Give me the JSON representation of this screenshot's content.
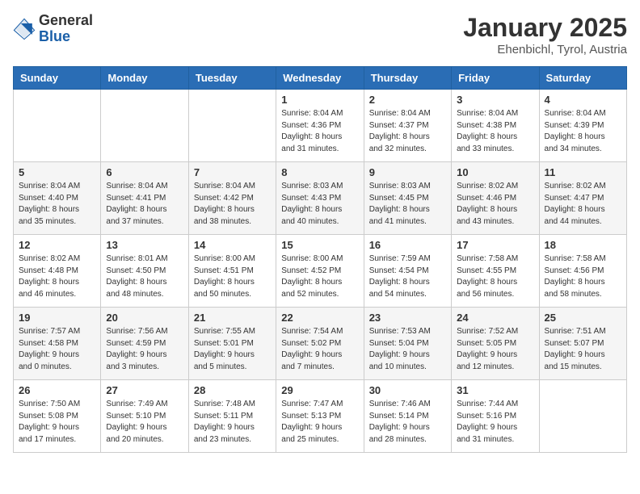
{
  "header": {
    "logo_line1": "General",
    "logo_line2": "Blue",
    "month": "January 2025",
    "location": "Ehenbichl, Tyrol, Austria"
  },
  "weekdays": [
    "Sunday",
    "Monday",
    "Tuesday",
    "Wednesday",
    "Thursday",
    "Friday",
    "Saturday"
  ],
  "weeks": [
    [
      {
        "day": "",
        "info": ""
      },
      {
        "day": "",
        "info": ""
      },
      {
        "day": "",
        "info": ""
      },
      {
        "day": "1",
        "info": "Sunrise: 8:04 AM\nSunset: 4:36 PM\nDaylight: 8 hours\nand 31 minutes."
      },
      {
        "day": "2",
        "info": "Sunrise: 8:04 AM\nSunset: 4:37 PM\nDaylight: 8 hours\nand 32 minutes."
      },
      {
        "day": "3",
        "info": "Sunrise: 8:04 AM\nSunset: 4:38 PM\nDaylight: 8 hours\nand 33 minutes."
      },
      {
        "day": "4",
        "info": "Sunrise: 8:04 AM\nSunset: 4:39 PM\nDaylight: 8 hours\nand 34 minutes."
      }
    ],
    [
      {
        "day": "5",
        "info": "Sunrise: 8:04 AM\nSunset: 4:40 PM\nDaylight: 8 hours\nand 35 minutes."
      },
      {
        "day": "6",
        "info": "Sunrise: 8:04 AM\nSunset: 4:41 PM\nDaylight: 8 hours\nand 37 minutes."
      },
      {
        "day": "7",
        "info": "Sunrise: 8:04 AM\nSunset: 4:42 PM\nDaylight: 8 hours\nand 38 minutes."
      },
      {
        "day": "8",
        "info": "Sunrise: 8:03 AM\nSunset: 4:43 PM\nDaylight: 8 hours\nand 40 minutes."
      },
      {
        "day": "9",
        "info": "Sunrise: 8:03 AM\nSunset: 4:45 PM\nDaylight: 8 hours\nand 41 minutes."
      },
      {
        "day": "10",
        "info": "Sunrise: 8:02 AM\nSunset: 4:46 PM\nDaylight: 8 hours\nand 43 minutes."
      },
      {
        "day": "11",
        "info": "Sunrise: 8:02 AM\nSunset: 4:47 PM\nDaylight: 8 hours\nand 44 minutes."
      }
    ],
    [
      {
        "day": "12",
        "info": "Sunrise: 8:02 AM\nSunset: 4:48 PM\nDaylight: 8 hours\nand 46 minutes."
      },
      {
        "day": "13",
        "info": "Sunrise: 8:01 AM\nSunset: 4:50 PM\nDaylight: 8 hours\nand 48 minutes."
      },
      {
        "day": "14",
        "info": "Sunrise: 8:00 AM\nSunset: 4:51 PM\nDaylight: 8 hours\nand 50 minutes."
      },
      {
        "day": "15",
        "info": "Sunrise: 8:00 AM\nSunset: 4:52 PM\nDaylight: 8 hours\nand 52 minutes."
      },
      {
        "day": "16",
        "info": "Sunrise: 7:59 AM\nSunset: 4:54 PM\nDaylight: 8 hours\nand 54 minutes."
      },
      {
        "day": "17",
        "info": "Sunrise: 7:58 AM\nSunset: 4:55 PM\nDaylight: 8 hours\nand 56 minutes."
      },
      {
        "day": "18",
        "info": "Sunrise: 7:58 AM\nSunset: 4:56 PM\nDaylight: 8 hours\nand 58 minutes."
      }
    ],
    [
      {
        "day": "19",
        "info": "Sunrise: 7:57 AM\nSunset: 4:58 PM\nDaylight: 9 hours\nand 0 minutes."
      },
      {
        "day": "20",
        "info": "Sunrise: 7:56 AM\nSunset: 4:59 PM\nDaylight: 9 hours\nand 3 minutes."
      },
      {
        "day": "21",
        "info": "Sunrise: 7:55 AM\nSunset: 5:01 PM\nDaylight: 9 hours\nand 5 minutes."
      },
      {
        "day": "22",
        "info": "Sunrise: 7:54 AM\nSunset: 5:02 PM\nDaylight: 9 hours\nand 7 minutes."
      },
      {
        "day": "23",
        "info": "Sunrise: 7:53 AM\nSunset: 5:04 PM\nDaylight: 9 hours\nand 10 minutes."
      },
      {
        "day": "24",
        "info": "Sunrise: 7:52 AM\nSunset: 5:05 PM\nDaylight: 9 hours\nand 12 minutes."
      },
      {
        "day": "25",
        "info": "Sunrise: 7:51 AM\nSunset: 5:07 PM\nDaylight: 9 hours\nand 15 minutes."
      }
    ],
    [
      {
        "day": "26",
        "info": "Sunrise: 7:50 AM\nSunset: 5:08 PM\nDaylight: 9 hours\nand 17 minutes."
      },
      {
        "day": "27",
        "info": "Sunrise: 7:49 AM\nSunset: 5:10 PM\nDaylight: 9 hours\nand 20 minutes."
      },
      {
        "day": "28",
        "info": "Sunrise: 7:48 AM\nSunset: 5:11 PM\nDaylight: 9 hours\nand 23 minutes."
      },
      {
        "day": "29",
        "info": "Sunrise: 7:47 AM\nSunset: 5:13 PM\nDaylight: 9 hours\nand 25 minutes."
      },
      {
        "day": "30",
        "info": "Sunrise: 7:46 AM\nSunset: 5:14 PM\nDaylight: 9 hours\nand 28 minutes."
      },
      {
        "day": "31",
        "info": "Sunrise: 7:44 AM\nSunset: 5:16 PM\nDaylight: 9 hours\nand 31 minutes."
      },
      {
        "day": "",
        "info": ""
      }
    ]
  ]
}
